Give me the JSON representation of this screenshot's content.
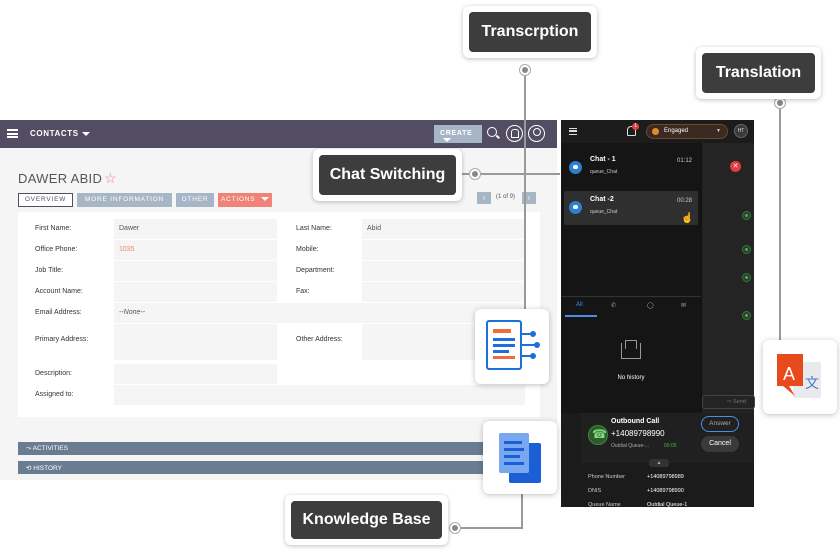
{
  "crm": {
    "module_label": "CONTACTS",
    "create_label": "CREATE",
    "record_title": "DAWER ABID",
    "tabs": [
      "OVERVIEW",
      "MORE INFORMATION",
      "OTHER",
      "ACTIONS"
    ],
    "pager_text": "(1 of 9)",
    "fields": {
      "first_name": {
        "label": "First Name:",
        "value": "Dawer"
      },
      "last_name": {
        "label": "Last Name:",
        "value": "Abid"
      },
      "office_phone": {
        "label": "Office Phone:",
        "value": "1035"
      },
      "mobile": {
        "label": "Mobile:",
        "value": ""
      },
      "job_title": {
        "label": "Job Title:",
        "value": ""
      },
      "department": {
        "label": "Department:",
        "value": ""
      },
      "account_name": {
        "label": "Account Name:",
        "value": ""
      },
      "fax": {
        "label": "Fax:",
        "value": ""
      },
      "email": {
        "label": "Email Address:",
        "value": "--None--"
      },
      "primary_address": {
        "label": "Primary Address:",
        "value": ""
      },
      "other_address": {
        "label": "Other Address:",
        "value": ""
      },
      "description": {
        "label": "Description:",
        "value": ""
      },
      "assigned_to": {
        "label": "Assigned to:",
        "value": ""
      }
    },
    "sections": [
      "ACTIVITIES",
      "HISTORY"
    ]
  },
  "phone": {
    "notification_count": "1",
    "status": "Engaged",
    "avatar_initials": "HT",
    "chats": [
      {
        "name": "Chat - 1",
        "queue": "queue_Chat",
        "time": "01:12"
      },
      {
        "name": "Chat -2",
        "queue": "queue_Chat",
        "time": "00:28"
      }
    ],
    "history_tab": "All",
    "empty_text": "No history",
    "send_label": "Send"
  },
  "call": {
    "title": "Outbound Call",
    "number": "+14089798990",
    "queue": "Outdial Queue-...",
    "timer": "00:05",
    "answer_label": "Answer",
    "cancel_label": "Cancel",
    "rows": [
      {
        "label": "Phone Number",
        "value": "+14089798989"
      },
      {
        "label": "DNIS",
        "value": "+14089798990"
      },
      {
        "label": "Queue Name",
        "value": "Outdial Queue-1"
      }
    ]
  },
  "callouts": {
    "transcription": "Transcrption",
    "translation": "Translation",
    "chat_switching": "Chat Switching",
    "knowledge_base": "Knowledge Base"
  },
  "colors": {
    "crm_header": "#534d64",
    "accent_red": "#f08377",
    "tab_blue": "#a6b6c7",
    "chat_blue": "#2d7fd0",
    "callout_bg": "#3d3d3d"
  }
}
